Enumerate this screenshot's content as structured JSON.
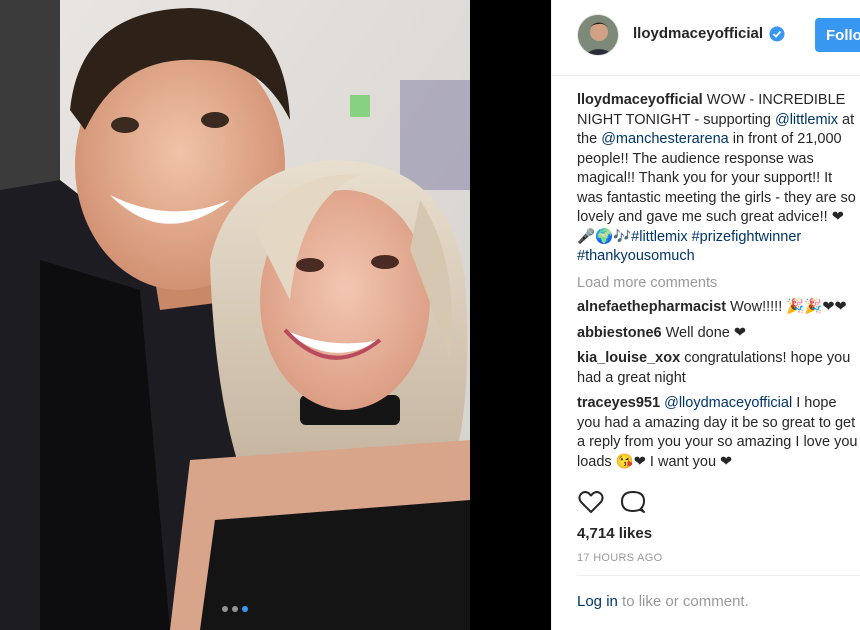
{
  "post": {
    "username": "lloydmaceyofficial",
    "follow_label": "Follow",
    "caption": {
      "user": "lloydmaceyofficial",
      "part1": " WOW - INCREDIBLE NIGHT TONIGHT - supporting ",
      "mention1": "@littlemix",
      "part2": " at the ",
      "mention2": "@manchesterarena",
      "part3": " in front of 21,000 people!! The audience response was magical!! Thank you for your support!! It was fantastic meeting the girls - they are so lovely and gave me such great advice!! ❤🎤🌍🎶",
      "tag1": "#littlemix",
      "tag2": "#prizefightwinner",
      "tag3": "#thankyousomuch"
    },
    "load_more": "Load more comments",
    "comments": [
      {
        "user": "alnefaethepharmacist",
        "text": " Wow!!!!! 🎉🎉❤❤"
      },
      {
        "user": "abbiestone6",
        "text": " Well done ❤"
      },
      {
        "user": "kia_louise_xox",
        "text": " congratulations! hope you had a great night"
      },
      {
        "user": "traceyes951",
        "mention": "@lloydmaceyofficial",
        "text": " I hope you had a amazing day it be so great to get a reply from you your so amazing I love you loads 😘❤ I want you ❤"
      }
    ],
    "likes": "4,714 likes",
    "time": "17 HOURS AGO",
    "login_link": "Log in",
    "login_rest": " to like or comment."
  },
  "carousel": {
    "count": 3,
    "active": 3
  },
  "colors": {
    "accent": "#3897f0",
    "link": "#003569",
    "muted": "#999999"
  },
  "icons": [
    "verified-badge-icon",
    "heart-icon",
    "comment-icon"
  ]
}
